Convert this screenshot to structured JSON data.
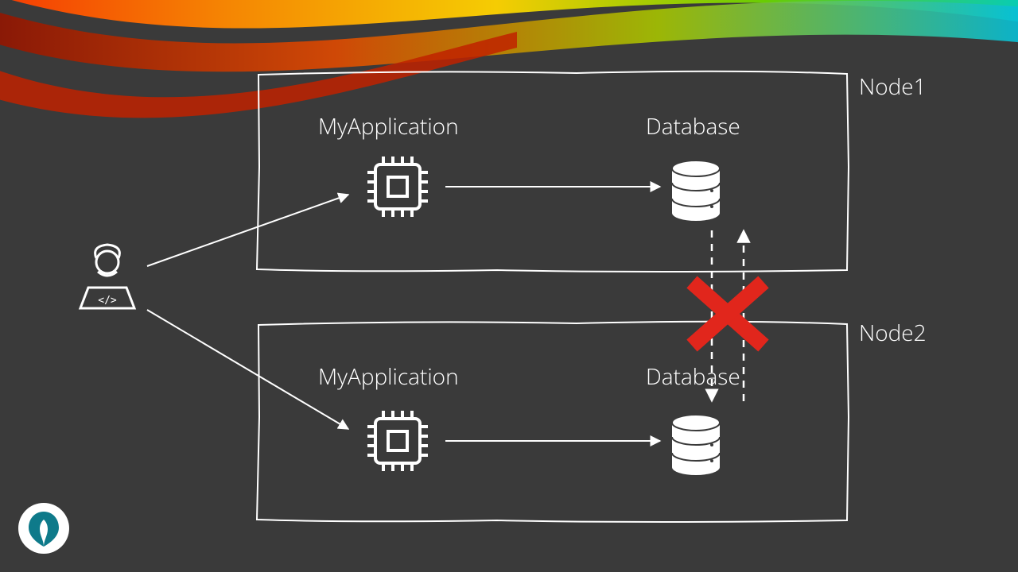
{
  "nodes": [
    {
      "label": "Node1",
      "app": "MyApplication",
      "db": "Database"
    },
    {
      "label": "Node2",
      "app": "MyApplication",
      "db": "Database"
    }
  ],
  "colors": {
    "bg": "#3a3a3a",
    "stroke": "#ffffff",
    "cross": "#e1261c",
    "badge_bg": "#ffffff",
    "badge_fg": "#0e7a8a"
  }
}
